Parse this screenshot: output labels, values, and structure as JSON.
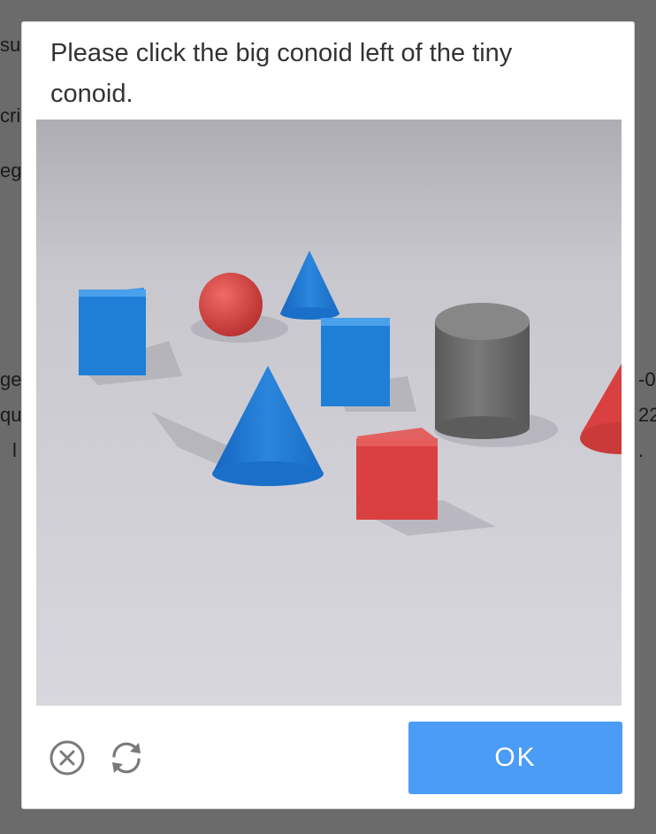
{
  "background_fragments": [
    "su",
    "cri",
    "eg",
    "ge",
    "qu",
    "l",
    "-0",
    "22",
    "."
  ],
  "captcha": {
    "prompt": "Please click the big conoid left of the tiny conoid.",
    "scene_objects": [
      "blue-cube",
      "red-sphere",
      "small-blue-cone",
      "blue-cube",
      "gray-cylinder",
      "large-blue-cone",
      "red-cube",
      "red-cone"
    ],
    "close_icon": "close-circle-icon",
    "refresh_icon": "refresh-icon",
    "ok_label": "OK",
    "colors": {
      "accent": "#4a9cf6",
      "blue_object": "#1f7fd6",
      "red_object": "#d9403f",
      "gray_object": "#6e6e6e"
    }
  }
}
